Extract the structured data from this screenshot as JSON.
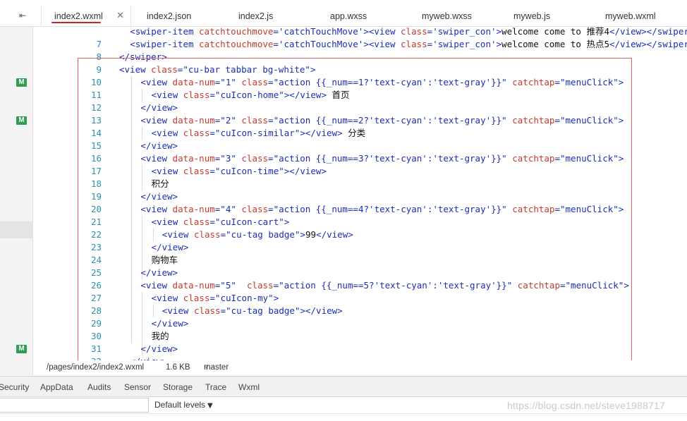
{
  "tabs": [
    {
      "label": "index2.wxml",
      "active": true
    },
    {
      "label": "index2.json"
    },
    {
      "label": "index2.js"
    },
    {
      "label": "app.wxss"
    },
    {
      "label": "myweb.wxss"
    },
    {
      "label": "myweb.js"
    },
    {
      "label": "myweb.wxml"
    }
  ],
  "icons": {
    "split": "split-editor-icon",
    "close": "close-icon",
    "branch": "git-branch-icon",
    "caret": "caret-down-icon",
    "modified_badge": "git-modified-badge"
  },
  "colors": {
    "highlight": "#e06266",
    "active_underline": "#c6261e",
    "line_number": "#2b91af",
    "tag": "#1a2eb5",
    "attr": "#c43a2c",
    "git_modified": "#2e9e52"
  },
  "git_markers": [
    {
      "line": 10,
      "label": "M"
    },
    {
      "line": 13,
      "label": "M"
    },
    {
      "line": 31,
      "label": "M"
    }
  ],
  "editor": {
    "first_line": 7,
    "lines": [
      {
        "n": "",
        "indent": 2,
        "parts": [
          [
            "t",
            "<swiper-item "
          ],
          [
            "a",
            "catchtouchmove"
          ],
          [
            "t",
            "="
          ],
          [
            "s",
            "'catchTouchMove'"
          ],
          [
            "t",
            "><view "
          ],
          [
            "a",
            "class"
          ],
          [
            "t",
            "="
          ],
          [
            "s",
            "'swiper_con'"
          ],
          [
            "t",
            ">"
          ],
          [
            "x",
            "welcome come to 推荐4"
          ],
          [
            "t",
            "</view></swiper-it"
          ]
        ]
      },
      {
        "n": "7",
        "indent": 2,
        "parts": [
          [
            "t",
            "<swiper-item "
          ],
          [
            "a",
            "catchtouchmove"
          ],
          [
            "t",
            "="
          ],
          [
            "s",
            "'catchTouchMove'"
          ],
          [
            "t",
            "><view "
          ],
          [
            "a",
            "class"
          ],
          [
            "t",
            "="
          ],
          [
            "s",
            "'swiper_con'"
          ],
          [
            "t",
            ">"
          ],
          [
            "x",
            "welcome come to 热点5"
          ],
          [
            "t",
            "</view></swiper-ite"
          ]
        ]
      },
      {
        "n": "8",
        "indent": 0,
        "parts": [
          [
            "t",
            "</swiper>"
          ]
        ]
      },
      {
        "n": "9",
        "indent": 0,
        "parts": [
          [
            "t",
            "<view "
          ],
          [
            "a",
            "class"
          ],
          [
            "t",
            "="
          ],
          [
            "s",
            "\"cu-bar tabbar bg-white\""
          ],
          [
            "t",
            ">"
          ]
        ]
      },
      {
        "n": "10",
        "indent": 4,
        "parts": [
          [
            "t",
            "<view "
          ],
          [
            "a",
            "data-num"
          ],
          [
            "t",
            "="
          ],
          [
            "s",
            "\"1\""
          ],
          [
            "t",
            " "
          ],
          [
            "a",
            "class"
          ],
          [
            "t",
            "="
          ],
          [
            "s",
            "\"action {{_num==1?'text-cyan':'text-gray'}}\""
          ],
          [
            "t",
            " "
          ],
          [
            "a",
            "catchtap"
          ],
          [
            "t",
            "="
          ],
          [
            "s",
            "\"menuClick\""
          ],
          [
            "t",
            ">"
          ]
        ]
      },
      {
        "n": "11",
        "indent": 6,
        "parts": [
          [
            "t",
            "<view "
          ],
          [
            "a",
            "class"
          ],
          [
            "t",
            "="
          ],
          [
            "s",
            "\"cuIcon-home\""
          ],
          [
            "t",
            "></view>"
          ],
          [
            "x",
            " 首页"
          ]
        ]
      },
      {
        "n": "12",
        "indent": 4,
        "parts": [
          [
            "t",
            "</view>"
          ]
        ]
      },
      {
        "n": "13",
        "indent": 4,
        "parts": [
          [
            "t",
            "<view "
          ],
          [
            "a",
            "data-num"
          ],
          [
            "t",
            "="
          ],
          [
            "s",
            "\"2\""
          ],
          [
            "t",
            " "
          ],
          [
            "a",
            "class"
          ],
          [
            "t",
            "="
          ],
          [
            "s",
            "\"action {{_num==2?'text-cyan':'text-gray'}}\""
          ],
          [
            "t",
            " "
          ],
          [
            "a",
            "catchtap"
          ],
          [
            "t",
            "="
          ],
          [
            "s",
            "\"menuClick\""
          ],
          [
            "t",
            ">"
          ]
        ]
      },
      {
        "n": "14",
        "indent": 6,
        "parts": [
          [
            "t",
            "<view "
          ],
          [
            "a",
            "class"
          ],
          [
            "t",
            "="
          ],
          [
            "s",
            "\"cuIcon-similar\""
          ],
          [
            "t",
            "></view>"
          ],
          [
            "x",
            " 分类"
          ]
        ]
      },
      {
        "n": "15",
        "indent": 4,
        "parts": [
          [
            "t",
            "</view>"
          ]
        ]
      },
      {
        "n": "16",
        "indent": 4,
        "parts": [
          [
            "t",
            "<view "
          ],
          [
            "a",
            "data-num"
          ],
          [
            "t",
            "="
          ],
          [
            "s",
            "\"3\""
          ],
          [
            "t",
            " "
          ],
          [
            "a",
            "class"
          ],
          [
            "t",
            "="
          ],
          [
            "s",
            "\"action {{_num==3?'text-cyan':'text-gray'}}\""
          ],
          [
            "t",
            " "
          ],
          [
            "a",
            "catchtap"
          ],
          [
            "t",
            "="
          ],
          [
            "s",
            "\"menuClick\""
          ],
          [
            "t",
            ">"
          ]
        ]
      },
      {
        "n": "17",
        "indent": 6,
        "parts": [
          [
            "t",
            "<view "
          ],
          [
            "a",
            "class"
          ],
          [
            "t",
            "="
          ],
          [
            "s",
            "\"cuIcon-time\""
          ],
          [
            "t",
            "></view>"
          ]
        ]
      },
      {
        "n": "18",
        "indent": 6,
        "parts": [
          [
            "x",
            "积分"
          ]
        ]
      },
      {
        "n": "19",
        "indent": 4,
        "parts": [
          [
            "t",
            "</view>"
          ]
        ]
      },
      {
        "n": "20",
        "indent": 4,
        "parts": [
          [
            "t",
            "<view "
          ],
          [
            "a",
            "data-num"
          ],
          [
            "t",
            "="
          ],
          [
            "s",
            "\"4\""
          ],
          [
            "t",
            " "
          ],
          [
            "a",
            "class"
          ],
          [
            "t",
            "="
          ],
          [
            "s",
            "\"action {{_num==4?'text-cyan':'text-gray'}}\""
          ],
          [
            "t",
            " "
          ],
          [
            "a",
            "catchtap"
          ],
          [
            "t",
            "="
          ],
          [
            "s",
            "\"menuClick\""
          ],
          [
            "t",
            ">"
          ]
        ]
      },
      {
        "n": "21",
        "indent": 6,
        "parts": [
          [
            "t",
            "<view "
          ],
          [
            "a",
            "class"
          ],
          [
            "t",
            "="
          ],
          [
            "s",
            "\"cuIcon-cart\""
          ],
          [
            "t",
            ">"
          ]
        ]
      },
      {
        "n": "22",
        "indent": 8,
        "parts": [
          [
            "t",
            "<view "
          ],
          [
            "a",
            "class"
          ],
          [
            "t",
            "="
          ],
          [
            "s",
            "\"cu-tag badge\""
          ],
          [
            "t",
            ">"
          ],
          [
            "x",
            "99"
          ],
          [
            "t",
            "</view>"
          ]
        ]
      },
      {
        "n": "23",
        "indent": 6,
        "parts": [
          [
            "t",
            "</view>"
          ]
        ]
      },
      {
        "n": "24",
        "indent": 6,
        "parts": [
          [
            "x",
            "购物车"
          ]
        ]
      },
      {
        "n": "25",
        "indent": 4,
        "parts": [
          [
            "t",
            "</view>"
          ]
        ]
      },
      {
        "n": "26",
        "indent": 4,
        "parts": [
          [
            "t",
            "<view "
          ],
          [
            "a",
            "data-num"
          ],
          [
            "t",
            "="
          ],
          [
            "s",
            "\"5\""
          ],
          [
            "t",
            "  "
          ],
          [
            "a",
            "class"
          ],
          [
            "t",
            "="
          ],
          [
            "s",
            "\"action {{_num==5?'text-cyan':'text-gray'}}\""
          ],
          [
            "t",
            " "
          ],
          [
            "a",
            "catchtap"
          ],
          [
            "t",
            "="
          ],
          [
            "s",
            "\"menuClick\""
          ],
          [
            "t",
            ">"
          ]
        ]
      },
      {
        "n": "27",
        "indent": 6,
        "parts": [
          [
            "t",
            "<view "
          ],
          [
            "a",
            "class"
          ],
          [
            "t",
            "="
          ],
          [
            "s",
            "\"cuIcon-my\""
          ],
          [
            "t",
            ">"
          ]
        ]
      },
      {
        "n": "28",
        "indent": 8,
        "parts": [
          [
            "t",
            "<view "
          ],
          [
            "a",
            "class"
          ],
          [
            "t",
            "="
          ],
          [
            "s",
            "\"cu-tag badge\""
          ],
          [
            "t",
            "></view>"
          ]
        ]
      },
      {
        "n": "29",
        "indent": 6,
        "parts": [
          [
            "t",
            "</view>"
          ]
        ]
      },
      {
        "n": "30",
        "indent": 6,
        "parts": [
          [
            "x",
            "我的"
          ]
        ]
      },
      {
        "n": "31",
        "indent": 4,
        "parts": [
          [
            "t",
            "</view>"
          ]
        ]
      },
      {
        "n": "32",
        "indent": 2,
        "parts": [
          [
            "t",
            "</view>"
          ]
        ]
      }
    ]
  },
  "statusbar": {
    "path": "/pages/index2/index2.wxml",
    "size": "1.6 KB",
    "branch": "master"
  },
  "devtools": {
    "tabs": [
      "Security",
      "AppData",
      "Audits",
      "Sensor",
      "Storage",
      "Trace",
      "Wxml"
    ],
    "levels_label": "Default levels"
  },
  "watermark": "https://blog.csdn.net/steve1988717"
}
